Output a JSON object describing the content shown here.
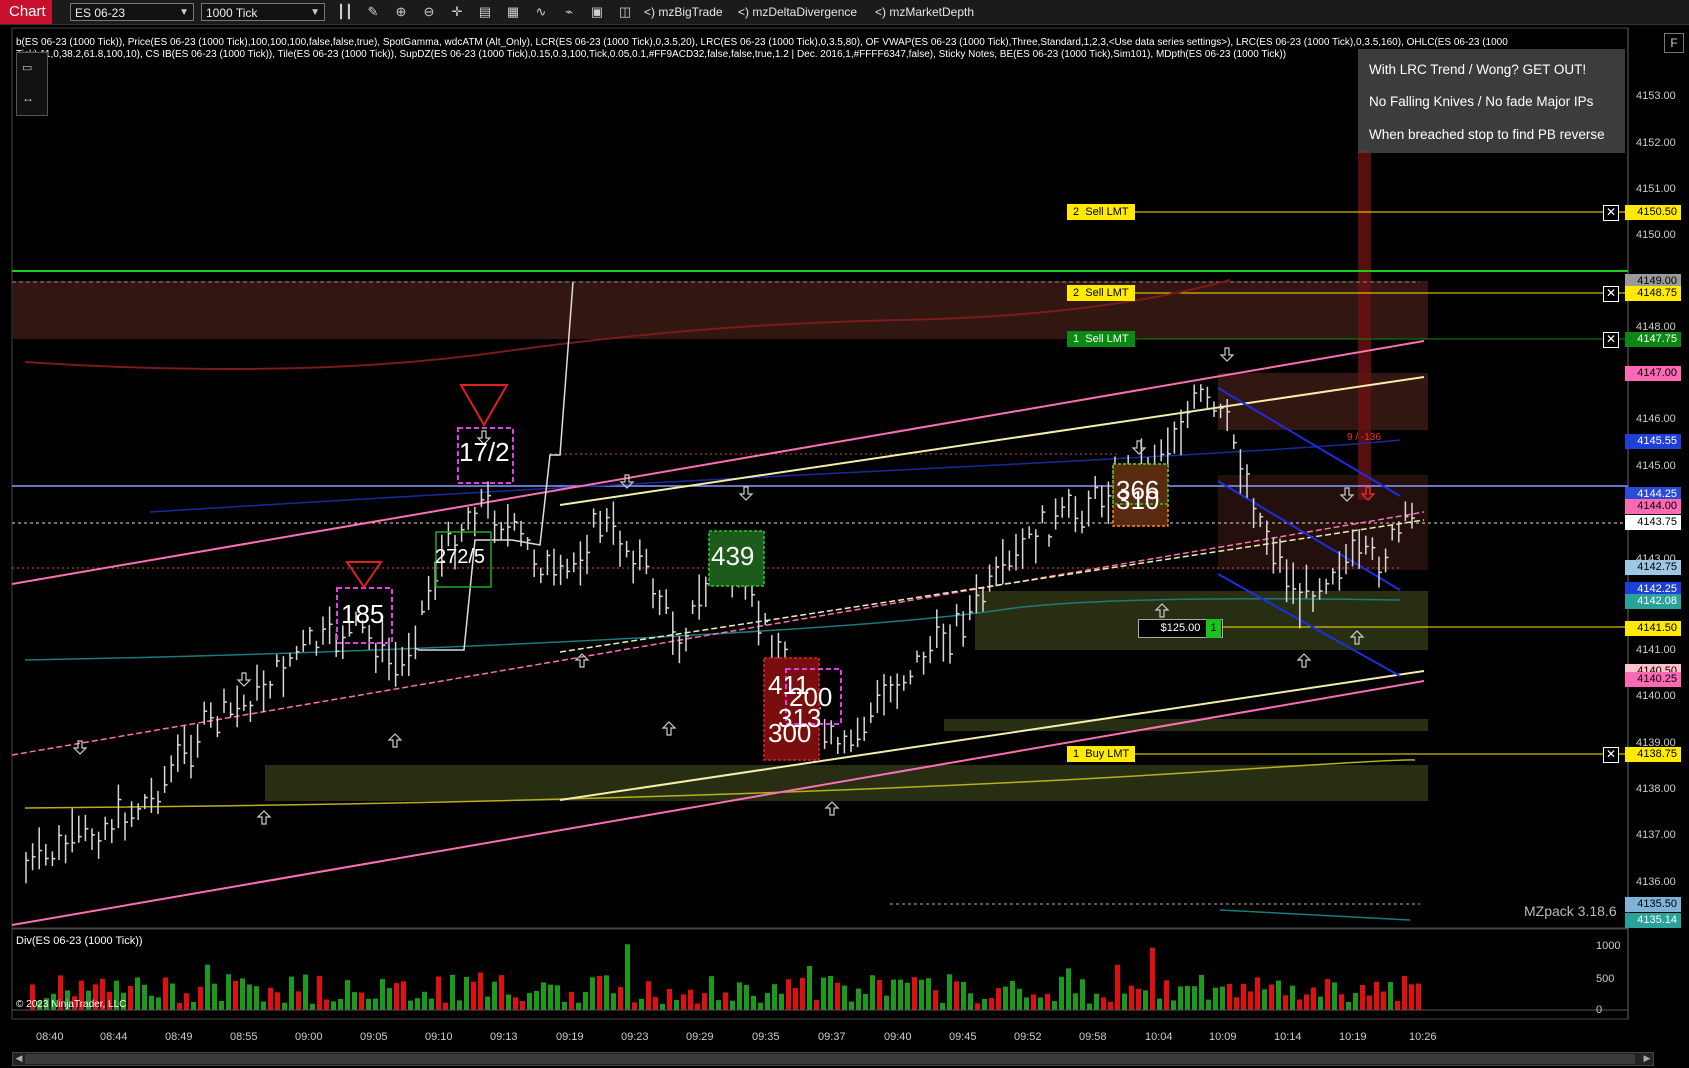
{
  "toolbar": {
    "tab": "Chart",
    "instrument": "ES 06-23",
    "interval": "1000 Tick",
    "strategies": [
      "<) mzBigTrade",
      "<) mzDeltaDivergence",
      "<) mzMarketDepth"
    ],
    "icons": [
      "bars-icon",
      "pencil-icon",
      "zoom-in-icon",
      "zoom-out-icon",
      "crosshair-icon",
      "properties-icon",
      "templates-icon",
      "indicators-icon",
      "strategies-icon",
      "chart-trader-icon",
      "data-box-icon"
    ]
  },
  "info_line": "b(ES 06-23 (1000 Tick)), Price(ES 06-23 (1000 Tick),100,100,100,false,false,true), SpotGamma, wdcATM (Alt_Only), LCR(ES 06-23 (1000 Tick),0,3.5,20), LRC(ES 06-23 (1000 Tick),0,3.5,80), OF VWAP(ES 06-23 (1000 Tick),Three,Standard,1,2,3,<Use data series settings>), LRC(ES 06-23 (1000 Tick),0,3.5,160), OHLC(ES 06-23 (1000 Tick),11,0,38.2,61.8,100,10), CS IB(ES 06-23 (1000 Tick)), Tile(ES 06-23 (1000 Tick)), SupDZ(ES 06-23 (1000 Tick),0.15,0.3,100,Tick,0.05,0.1,#FF9ACD32,false,false,true,1.2 | Dec. 2016,1,#FFFF6347,false), Sticky Notes, BE(ES 06-23 (1000 Tick),Sim101), MDpth(ES 06-23 (1000 Tick))",
  "notes": [
    "With LRC Trend / Wong? GET OUT!",
    "No Falling Knives  / No fade Major IPs",
    "When breached stop to find PB reverse"
  ],
  "orders": [
    {
      "qty": "2",
      "label": "Sell LMT",
      "price": "4150.50",
      "color": "#ffea00"
    },
    {
      "qty": "2",
      "label": "Sell LMT",
      "price": "4148.75",
      "color": "#ffea00"
    },
    {
      "qty": "1",
      "label": "Sell LMT",
      "price": "4147.75",
      "color": "#0a8a12"
    },
    {
      "qty": "1",
      "label": "Buy LMT",
      "price": "4138.75",
      "color": "#ffea00"
    }
  ],
  "price_labels": [
    {
      "text": "4150.50",
      "bg": "#ffea00"
    },
    {
      "text": "4149.00",
      "bg": "#9a9a9a"
    },
    {
      "text": "4148.75",
      "bg": "#ffea00"
    },
    {
      "text": "4147.75",
      "bg": "#0a8a12"
    },
    {
      "text": "4147.00",
      "bg": "#ff69b4"
    },
    {
      "text": "4145.55",
      "bg": "#1e3fd8"
    },
    {
      "text": "4144.25",
      "bg": "#2a4ad8"
    },
    {
      "text": "4144.00",
      "bg": "#ff69b4"
    },
    {
      "text": "4143.75",
      "bg": "#ffffff"
    },
    {
      "text": "4142.75",
      "bg": "#9ec7e6"
    },
    {
      "text": "4142.25",
      "bg": "#1e3fd8"
    },
    {
      "text": "4142.08",
      "bg": "#2aa19a"
    },
    {
      "text": "4141.50",
      "bg": "#ffea00"
    },
    {
      "text": "4140.50",
      "bg": "#ffc0cb"
    },
    {
      "text": "4140.25",
      "bg": "#ff69b4"
    },
    {
      "text": "4138.75",
      "bg": "#ffea00"
    },
    {
      "text": "4135.50",
      "bg": "#7fb3d8"
    },
    {
      "text": "4135.14",
      "bg": "#2aa19a"
    }
  ],
  "y_axis": [
    "4153.00",
    "4152.00",
    "4151.00",
    "4150.00",
    "4148.00",
    "4146.00",
    "4145.00",
    "4143.00",
    "4141.00",
    "4140.00",
    "4139.00",
    "4138.00",
    "4137.00",
    "4136.00"
  ],
  "x_axis": [
    "08:40",
    "08:44",
    "08:49",
    "08:55",
    "09:00",
    "09:05",
    "09:10",
    "09:13",
    "09:19",
    "09:23",
    "09:29",
    "09:35",
    "09:37",
    "09:40",
    "09:45",
    "09:52",
    "09:58",
    "10:04",
    "10:09",
    "10:14",
    "10:19",
    "10:26"
  ],
  "box_labels": [
    "17/2",
    "272/5",
    "185",
    "439",
    "411",
    "313",
    "300",
    "200",
    "366",
    "310"
  ],
  "signal_text": "9 / -136",
  "position": {
    "pnl": "$125.00",
    "qty": "1"
  },
  "watermark": "MZpack 3.18.6",
  "div_panel": {
    "title": "Div(ES 06-23 (1000 Tick))",
    "axis": [
      "1000",
      "500",
      "0"
    ],
    "copyright": "© 2023 NinjaTrader, LLC"
  },
  "f_button": "F"
}
